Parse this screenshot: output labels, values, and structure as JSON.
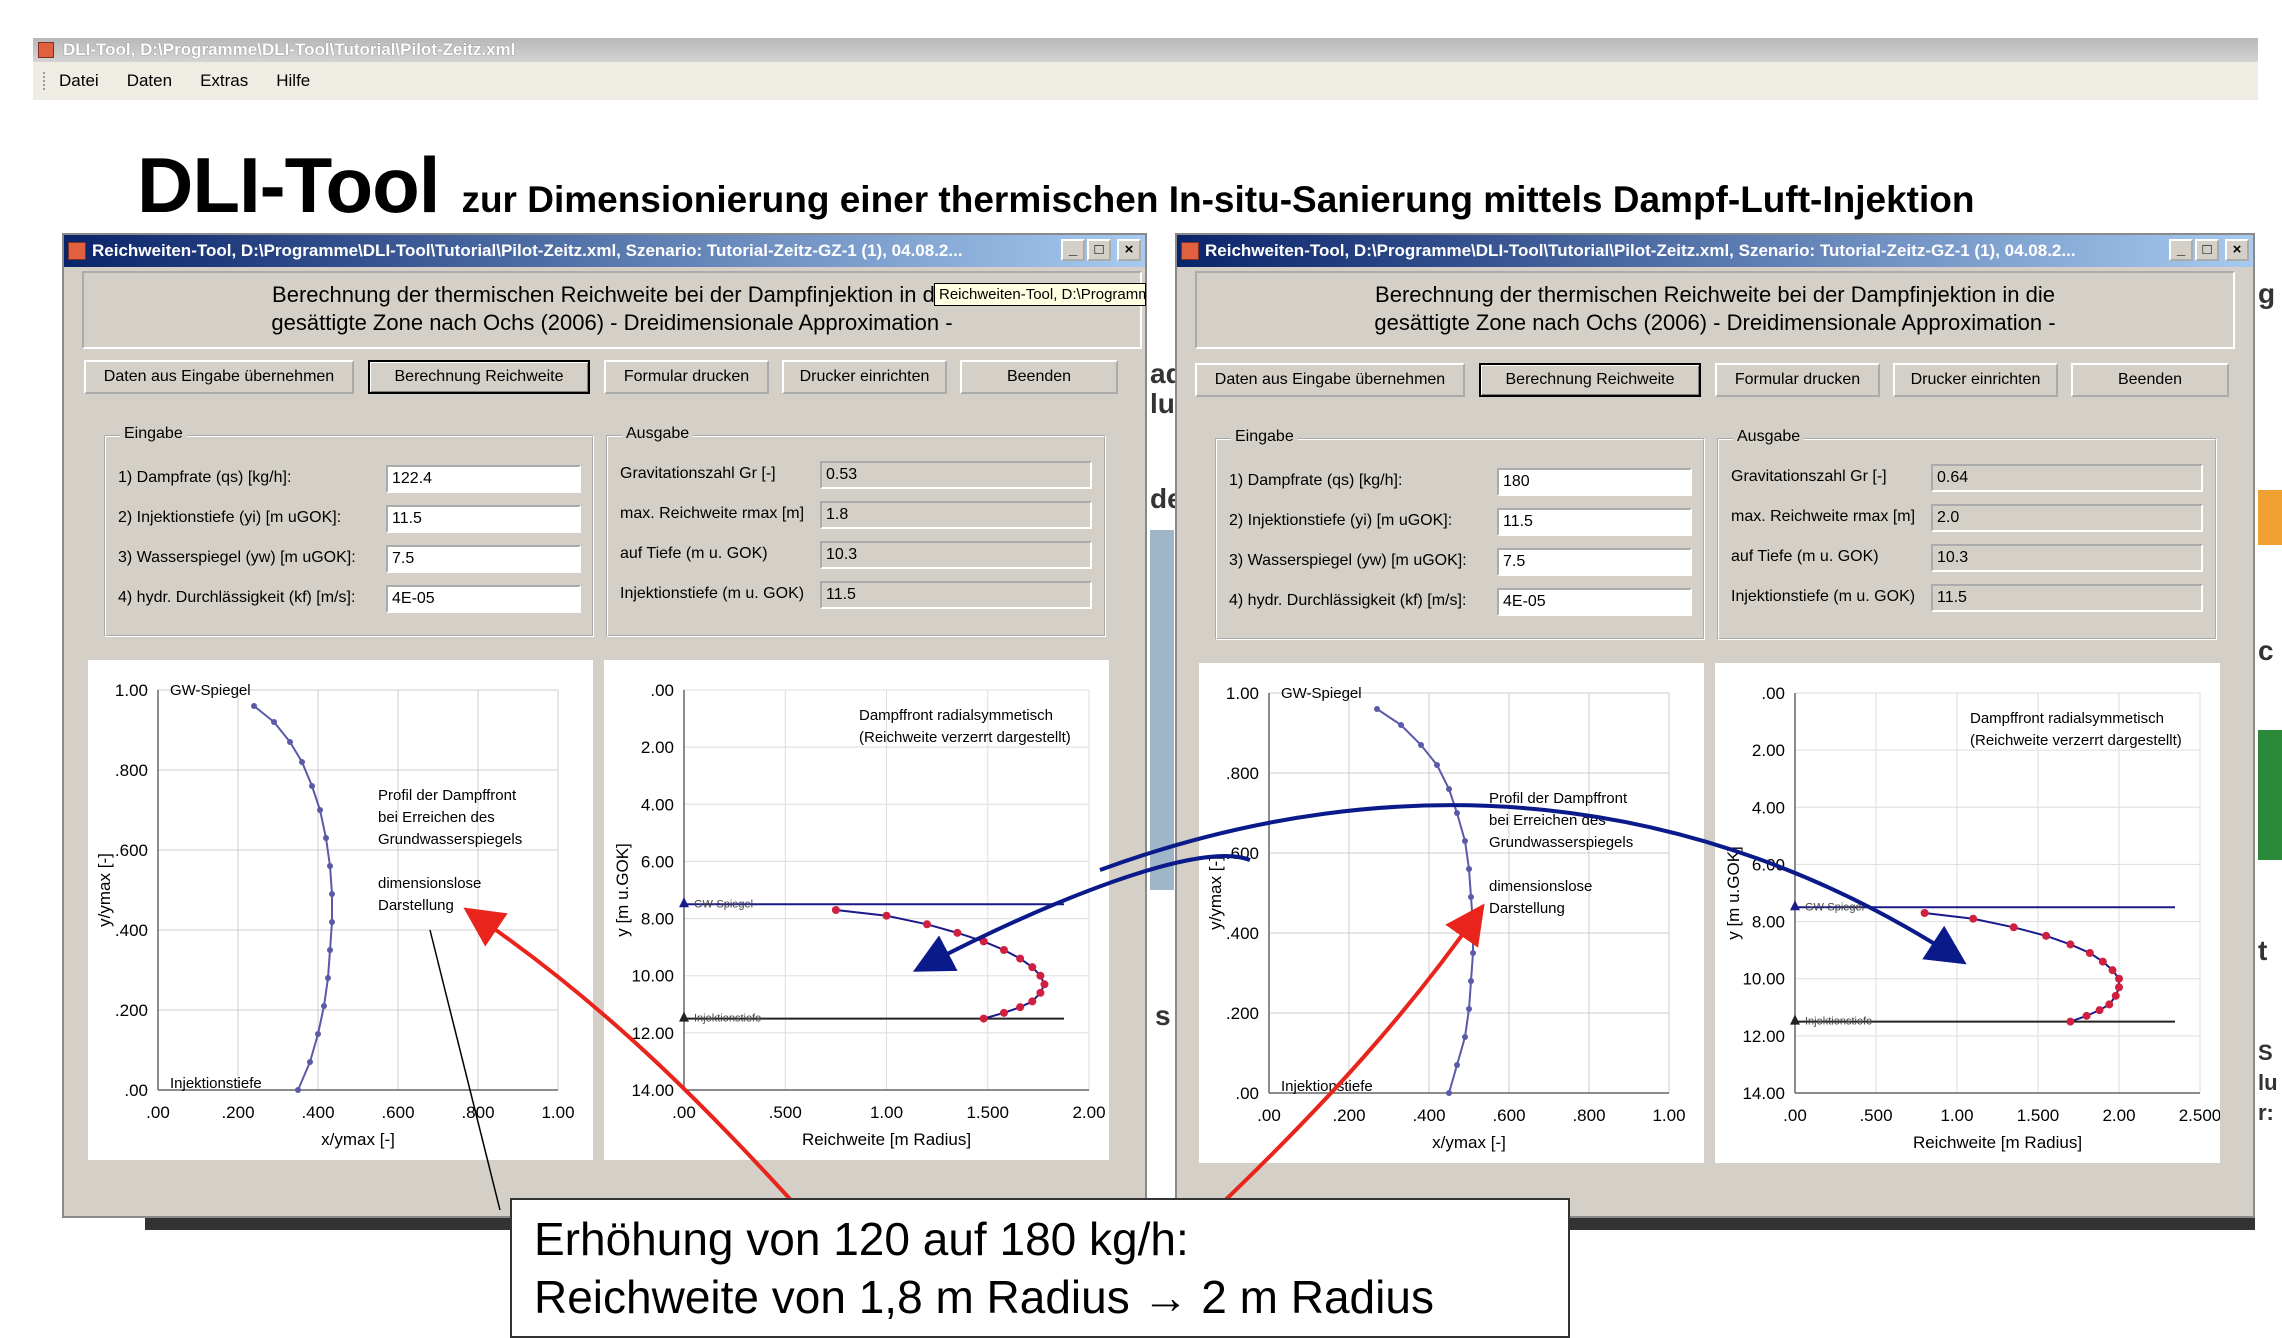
{
  "main_window": {
    "title": "DLI-Tool, D:\\Programme\\DLI-Tool\\Tutorial\\Pilot-Zeitz.xml",
    "menu": [
      "Datei",
      "Daten",
      "Extras",
      "Hilfe"
    ]
  },
  "slide": {
    "title": "DLI-Tool",
    "subtitle": "zur Dimensionierung einer thermischen In-situ-Sanierung mittels Dampf-Luft-Injektion",
    "callout_line1": "Erhöhung von 120 auf 180 kg/h:",
    "callout_line2": "Reichweite von 1,8 m Radius → 2 m Radius",
    "fragments": [
      "ad",
      "lu",
      "de",
      "s",
      "g",
      "c",
      "t",
      "S",
      "lu",
      "r:"
    ]
  },
  "dialogs": [
    {
      "title": "Reichweiten-Tool, D:\\Programme\\DLI-Tool\\Tutorial\\Pilot-Zeitz.xml, Szenario: Tutorial-Zeitz-GZ-1 (1), 04.08.2...",
      "tooltip": "Reichweiten-Tool, D:\\Programm",
      "header_line1": "Berechnung der thermischen Reichweite bei der Dampfinjektion in die",
      "header_line2": "gesättigte Zone nach Ochs (2006) - Dreidimensionale Approximation -",
      "buttons": [
        "Daten aus Eingabe übernehmen",
        "Berechnung Reichweite",
        "Formular drucken",
        "Drucker einrichten",
        "Beenden"
      ],
      "eingabe_label": "Eingabe",
      "ausgabe_label": "Ausgabe",
      "inputs": [
        {
          "label": "1) Dampfrate (qs) [kg/h]:",
          "value": "122.4"
        },
        {
          "label": "2) Injektionstiefe (yi) [m uGOK]:",
          "value": "11.5"
        },
        {
          "label": "3) Wasserspiegel (yw) [m uGOK]:",
          "value": "7.5"
        },
        {
          "label": "4) hydr. Durchlässigkeit (kf) [m/s]:",
          "value": "4E-05"
        }
      ],
      "outputs": [
        {
          "label": "Gravitationszahl Gr [-]",
          "value": "0.53"
        },
        {
          "label": "max. Reichweite rmax [m]",
          "value": "1.8"
        },
        {
          "label": "auf Tiefe (m u. GOK)",
          "value": "10.3"
        },
        {
          "label": "Injektionstiefe (m u. GOK)",
          "value": "11.5"
        }
      ],
      "profile_chart": {
        "xlabel": "x/ymax [-]",
        "ylabel": "y/ymax [-]",
        "xticks": [
          ".00",
          ".200",
          ".400",
          ".600",
          ".800",
          "1.00"
        ],
        "yticks": [
          "1.00",
          ".800",
          ".600",
          ".400",
          ".200",
          ".00"
        ],
        "top_label": "GW-Spiegel",
        "bottom_label": "Injektionstiefe",
        "annotation": [
          "Profil der Dampffront",
          "bei Erreichen des",
          "Grundwasserspiegels",
          "",
          "dimensionslose",
          "Darstellung"
        ]
      },
      "front_chart": {
        "xlabel": "Reichweite [m Radius]",
        "ylabel": "y [m u.GOK]",
        "xticks": [
          ".00",
          ".500",
          "1.00",
          "1.500",
          "2.00"
        ],
        "yticks": [
          ".00",
          "2.00",
          "4.00",
          "6.00",
          "8.00",
          "10.00",
          "12.00",
          "14.00"
        ],
        "annotation": [
          "Dampffront radialsymmetisch",
          "(Reichweite verzerrt dargestellt)"
        ],
        "gw_label": "GW-Spiegel",
        "inj_label": "Injektionstiefe"
      }
    },
    {
      "title": "Reichweiten-Tool, D:\\Programme\\DLI-Tool\\Tutorial\\Pilot-Zeitz.xml, Szenario: Tutorial-Zeitz-GZ-1 (1), 04.08.2...",
      "header_line1": "Berechnung der thermischen Reichweite bei der Dampfinjektion in die",
      "header_line2": "gesättigte Zone nach Ochs (2006) - Dreidimensionale Approximation -",
      "buttons": [
        "Daten aus Eingabe übernehmen",
        "Berechnung Reichweite",
        "Formular drucken",
        "Drucker einrichten",
        "Beenden"
      ],
      "eingabe_label": "Eingabe",
      "ausgabe_label": "Ausgabe",
      "inputs": [
        {
          "label": "1) Dampfrate (qs) [kg/h]:",
          "value": "180"
        },
        {
          "label": "2) Injektionstiefe (yi) [m uGOK]:",
          "value": "11.5"
        },
        {
          "label": "3) Wasserspiegel (yw) [m uGOK]:",
          "value": "7.5"
        },
        {
          "label": "4) hydr. Durchlässigkeit (kf) [m/s]:",
          "value": "4E-05"
        }
      ],
      "outputs": [
        {
          "label": "Gravitationszahl Gr [-]",
          "value": "0.64"
        },
        {
          "label": "max. Reichweite rmax [m]",
          "value": "2.0"
        },
        {
          "label": "auf Tiefe (m u. GOK)",
          "value": "10.3"
        },
        {
          "label": "Injektionstiefe (m u. GOK)",
          "value": "11.5"
        }
      ],
      "profile_chart": {
        "xlabel": "x/ymax [-]",
        "ylabel": "y/ymax [-]",
        "xticks": [
          ".00",
          ".200",
          ".400",
          ".600",
          ".800",
          "1.00"
        ],
        "yticks": [
          "1.00",
          ".800",
          ".600",
          ".400",
          ".200",
          ".00"
        ],
        "top_label": "GW-Spiegel",
        "bottom_label": "Injektionstiefe",
        "annotation": [
          "Profil der Dampffront",
          "bei Erreichen des",
          "Grundwasserspiegels",
          "",
          "dimensionslose",
          "Darstellung"
        ]
      },
      "front_chart": {
        "xlabel": "Reichweite [m Radius]",
        "ylabel": "y [m u.GOK]",
        "xticks": [
          ".00",
          ".500",
          "1.00",
          "1.500",
          "2.00",
          "2.500"
        ],
        "yticks": [
          ".00",
          "2.00",
          "4.00",
          "6.00",
          "8.00",
          "10.00",
          "12.00",
          "14.00"
        ],
        "annotation": [
          "Dampffront radialsymmetisch",
          "(Reichweite verzerrt dargestellt)"
        ],
        "gw_label": "GW-Spiegel",
        "inj_label": "Injektionstiefe"
      }
    }
  ],
  "chart_data": [
    {
      "type": "line",
      "title": "",
      "xlabel": "x/ymax [-]",
      "ylabel": "y/ymax [-]",
      "xlim": [
        0,
        1
      ],
      "ylim": [
        0,
        1
      ],
      "x": [
        0.35,
        0.38,
        0.4,
        0.415,
        0.425,
        0.43,
        0.435,
        0.435,
        0.43,
        0.42,
        0.405,
        0.385,
        0.36,
        0.33,
        0.29,
        0.24
      ],
      "y": [
        0.0,
        0.07,
        0.14,
        0.21,
        0.28,
        0.35,
        0.42,
        0.49,
        0.56,
        0.63,
        0.7,
        0.76,
        0.82,
        0.87,
        0.92,
        0.96
      ]
    },
    {
      "type": "line",
      "title": "",
      "xlabel": "Reichweite [m Radius]",
      "ylabel": "y [m u.GOK]",
      "xlim": [
        0,
        2
      ],
      "ylim": [
        14,
        0
      ],
      "x": [
        0.75,
        1.0,
        1.2,
        1.35,
        1.48,
        1.58,
        1.66,
        1.72,
        1.76,
        1.78,
        1.76,
        1.72,
        1.66,
        1.58,
        1.48
      ],
      "y": [
        7.7,
        7.9,
        8.2,
        8.5,
        8.8,
        9.1,
        9.4,
        9.7,
        10.0,
        10.3,
        10.6,
        10.9,
        11.1,
        11.3,
        11.5
      ]
    },
    {
      "type": "line",
      "title": "",
      "xlabel": "x/ymax [-]",
      "ylabel": "y/ymax [-]",
      "xlim": [
        0,
        1
      ],
      "ylim": [
        0,
        1
      ],
      "x": [
        0.45,
        0.47,
        0.49,
        0.5,
        0.505,
        0.51,
        0.51,
        0.505,
        0.5,
        0.49,
        0.47,
        0.45,
        0.42,
        0.38,
        0.33,
        0.27
      ],
      "y": [
        0.0,
        0.07,
        0.14,
        0.21,
        0.28,
        0.35,
        0.42,
        0.49,
        0.56,
        0.63,
        0.7,
        0.76,
        0.82,
        0.87,
        0.92,
        0.96
      ]
    },
    {
      "type": "line",
      "title": "",
      "xlabel": "Reichweite [m Radius]",
      "ylabel": "y [m u.GOK]",
      "xlim": [
        0,
        2.5
      ],
      "ylim": [
        14,
        0
      ],
      "x": [
        0.8,
        1.1,
        1.35,
        1.55,
        1.7,
        1.82,
        1.9,
        1.96,
        2.0,
        2.0,
        1.98,
        1.94,
        1.88,
        1.8,
        1.7
      ],
      "y": [
        7.7,
        7.9,
        8.2,
        8.5,
        8.8,
        9.1,
        9.4,
        9.7,
        10.0,
        10.3,
        10.6,
        10.9,
        11.1,
        11.3,
        11.5
      ]
    }
  ]
}
